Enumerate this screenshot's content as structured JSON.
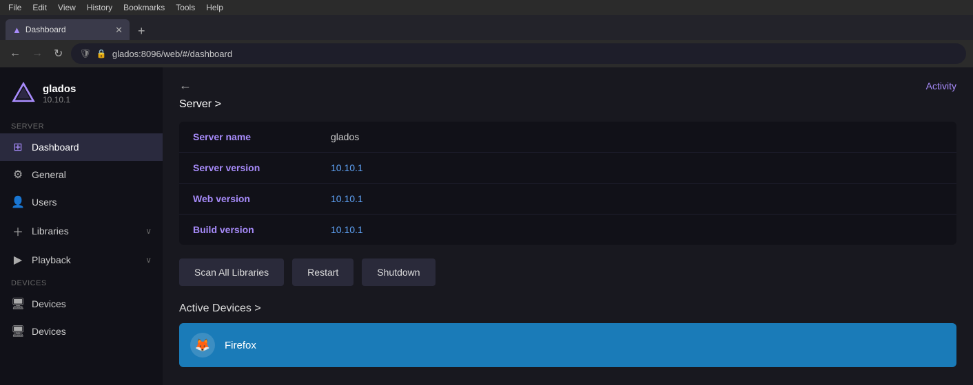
{
  "browser": {
    "menu_items": [
      "File",
      "Edit",
      "View",
      "History",
      "Bookmarks",
      "Tools",
      "Help"
    ],
    "tab_title": "Dashboard",
    "tab_favicon": "▲",
    "new_tab_btn": "+",
    "back_disabled": false,
    "forward_disabled": true,
    "reload_label": "↻",
    "address": "glados:8096/web/#/dashboard",
    "shield": "🛡",
    "lock": "🔒"
  },
  "sidebar": {
    "server_name": "glados",
    "server_version": "10.10.1",
    "section_server": "Server",
    "nav_items": [
      {
        "id": "dashboard",
        "label": "Dashboard",
        "icon": "⊞",
        "active": true,
        "has_chevron": false
      },
      {
        "id": "general",
        "label": "General",
        "icon": "⚙",
        "active": false,
        "has_chevron": false
      },
      {
        "id": "users",
        "label": "Users",
        "icon": "👤",
        "active": false,
        "has_chevron": false
      },
      {
        "id": "libraries",
        "label": "Libraries",
        "icon": "＋",
        "active": false,
        "has_chevron": true
      },
      {
        "id": "playback",
        "label": "Playback",
        "icon": "▶",
        "active": false,
        "has_chevron": true
      }
    ],
    "section_devices": "Devices",
    "devices_item": {
      "id": "devices",
      "label": "Devices",
      "icon": "🖥",
      "active": false,
      "has_chevron": false
    }
  },
  "content": {
    "back_label": "←",
    "breadcrumb": "Server >",
    "activity_label": "Activity",
    "server_info": {
      "fields": [
        {
          "label": "Server name",
          "value": "glados"
        },
        {
          "label": "Server version",
          "value": "10.10.1"
        },
        {
          "label": "Web version",
          "value": "10.10.1"
        },
        {
          "label": "Build version",
          "value": "10.10.1"
        }
      ]
    },
    "buttons": [
      {
        "id": "scan-all-libraries",
        "label": "Scan All Libraries"
      },
      {
        "id": "restart",
        "label": "Restart"
      },
      {
        "id": "shutdown",
        "label": "Shutdown"
      }
    ],
    "active_devices_title": "Active Devices >",
    "device": {
      "name": "Firefox",
      "icon": "🦊"
    }
  }
}
